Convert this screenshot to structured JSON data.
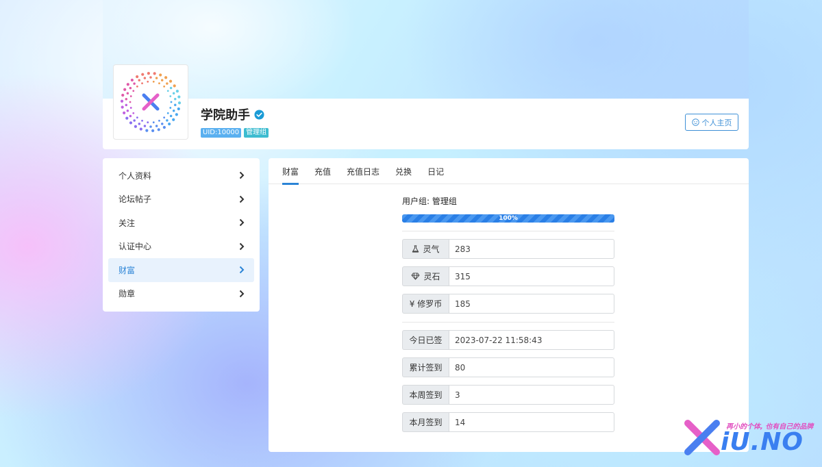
{
  "profile": {
    "username": "学院助手",
    "uid_tag": "UID:10000",
    "group_tag": "管理组",
    "homepage_button": "个人主页"
  },
  "sidebar": {
    "items": [
      {
        "label": "个人资料",
        "active": false
      },
      {
        "label": "论坛帖子",
        "active": false
      },
      {
        "label": "关注",
        "active": false
      },
      {
        "label": "认证中心",
        "active": false
      },
      {
        "label": "财富",
        "active": true
      },
      {
        "label": "勋章",
        "active": false
      }
    ]
  },
  "tabs": [
    {
      "label": "财富",
      "active": true
    },
    {
      "label": "充值",
      "active": false
    },
    {
      "label": "充值日志",
      "active": false
    },
    {
      "label": "兑换",
      "active": false
    },
    {
      "label": "日记",
      "active": false
    }
  ],
  "wealth": {
    "group_line": "用户组: 管理组",
    "progress_label": "100%",
    "progress": 1.0,
    "currencies": [
      {
        "icon": "flask-icon",
        "label": "灵气",
        "value": "283"
      },
      {
        "icon": "diamond-icon",
        "label": "灵石",
        "value": "315"
      },
      {
        "icon": "yen-icon",
        "label": "¥ 修罗币",
        "value": "185"
      }
    ],
    "signin": [
      {
        "label": "今日已签",
        "value": "2023-07-22 11:58:43"
      },
      {
        "label": "累计签到",
        "value": "80"
      },
      {
        "label": "本周签到",
        "value": "3"
      },
      {
        "label": "本月签到",
        "value": "14"
      }
    ]
  },
  "watermark": {
    "slogan": "再小的个体, 也有自己的品牌",
    "logo_text": "iU.NO"
  },
  "colors": {
    "accent": "#2b84d6",
    "progress": "#2a7fe6",
    "tag_uid": "#5ab0f0",
    "tag_group": "#3dbcd0",
    "verified": "#1a9bd6"
  }
}
